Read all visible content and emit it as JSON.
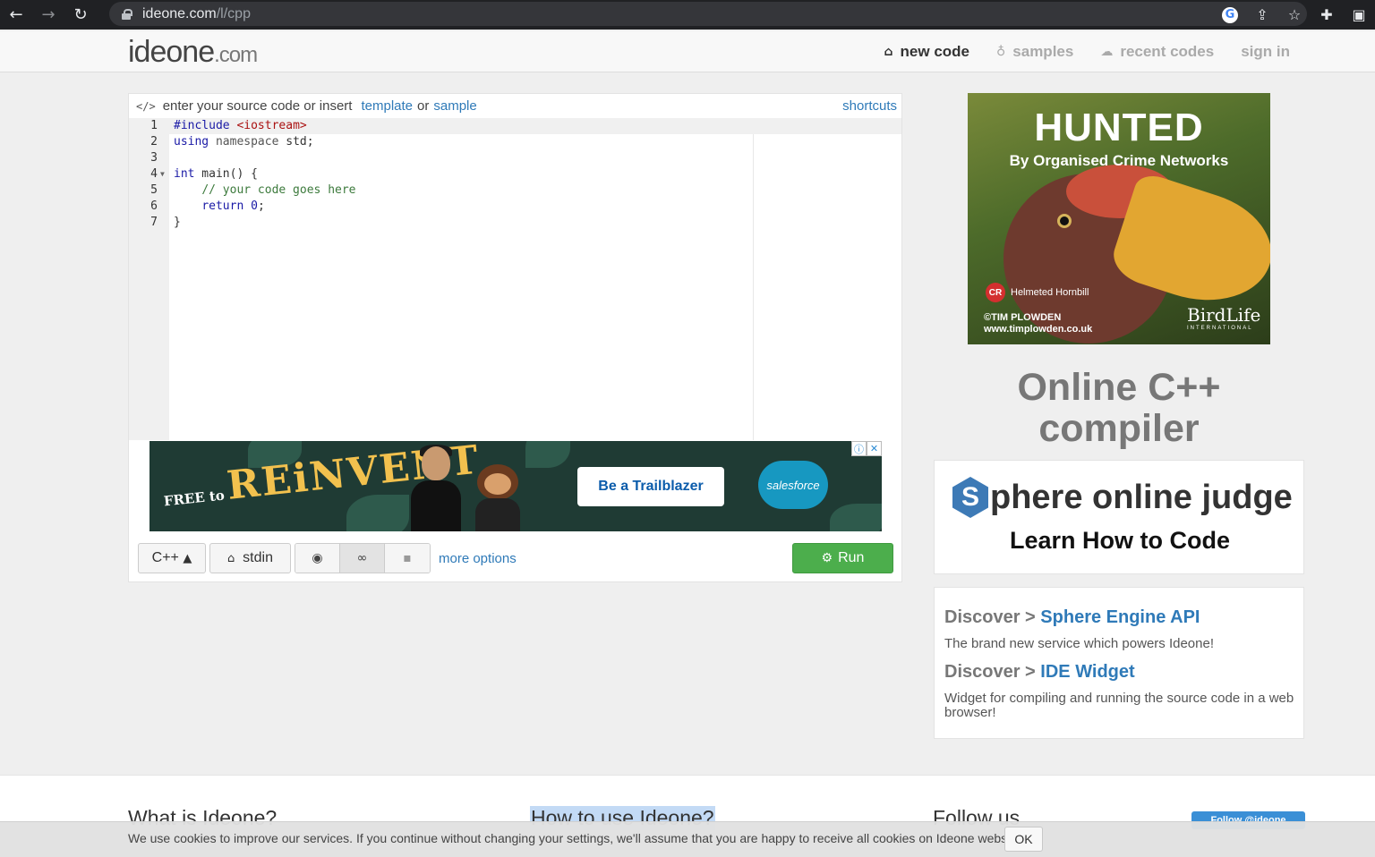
{
  "browser": {
    "url_host": "ideone.com",
    "url_path": "/l/cpp"
  },
  "site": {
    "logo_main": "ideone",
    "logo_suffix": ".com",
    "nav": [
      {
        "label": "new code",
        "icon": "home-icon",
        "active": true
      },
      {
        "label": "samples",
        "icon": "lightbulb-icon",
        "active": false
      },
      {
        "label": "recent codes",
        "icon": "cloud-icon",
        "active": false
      },
      {
        "label": "sign in",
        "icon": "",
        "active": false
      }
    ]
  },
  "editor": {
    "head_prefix": "enter your source code or insert",
    "template_link": "template",
    "or": "or",
    "sample_link": "sample",
    "shortcuts": "shortcuts",
    "lines": [
      {
        "n": "1",
        "text": "#include <iostream>"
      },
      {
        "n": "2",
        "text": "using namespace std;"
      },
      {
        "n": "3",
        "text": ""
      },
      {
        "n": "4",
        "text": "int main() {"
      },
      {
        "n": "5",
        "text": "    // your code goes here"
      },
      {
        "n": "6",
        "text": "    return 0;"
      },
      {
        "n": "7",
        "text": "}"
      }
    ]
  },
  "banner_ad": {
    "headline_prefix": "FREE to",
    "headline": "REiNVENT",
    "cta": "Be a Trailblazer",
    "brand": "salesforce",
    "info": "ⓘ",
    "close": "✕"
  },
  "toolbar": {
    "language": "C++",
    "stdin": "stdin",
    "more_options": "more options",
    "run": "Run"
  },
  "sidebar": {
    "ad": {
      "title": "HUNTED",
      "subtitle": "By Organised Crime Networks",
      "status_code": "CR",
      "species": "Helmeted Hornbill",
      "credit_line1": "©TIM PLOWDEN",
      "credit_line2": "www.timplowden.co.uk",
      "logo": "BirdLife",
      "logo_sub": "INTERNATIONAL"
    },
    "heading": "Online C++ compiler",
    "spoj_letter": "S",
    "spoj_name": "phere online judge",
    "spoj_tagline": "Learn How to Code",
    "discover": [
      {
        "prefix": "Discover >",
        "link": "Sphere Engine API",
        "desc": "The brand new service which powers Ideone!"
      },
      {
        "prefix": "Discover >",
        "link": "IDE Widget",
        "desc": "Widget for compiling and running the source code in a web browser!"
      }
    ]
  },
  "footer": {
    "col1": "What is Ideone?",
    "col2": "How to use Ideone?",
    "col3": "Follow us",
    "follow_button": "Follow @ideone"
  },
  "cookie": {
    "text": "We use cookies to improve our services. If you continue without changing your settings, we'll assume that you are happy to receive all cookies on Ideone website.",
    "ok": "OK"
  },
  "colors": {
    "link": "#2f7ab8",
    "run_green": "#4cae4c",
    "chrome_dark": "#202124"
  }
}
